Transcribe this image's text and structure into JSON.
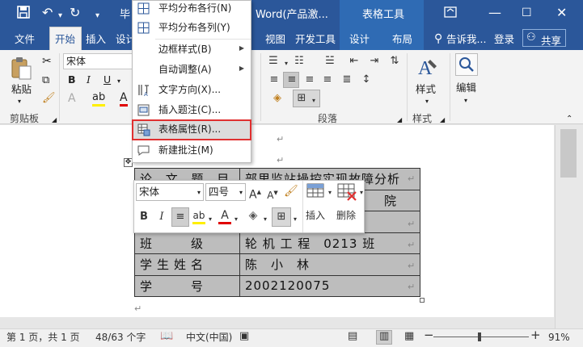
{
  "titlebar": {
    "doc_title_left": "毕",
    "doc_title_right": "Word(产品激...",
    "context_group": "表格工具"
  },
  "tabs": {
    "file": "文件",
    "home": "开始",
    "insert": "插入",
    "design_trunc": "设计",
    "view": "视图",
    "developer": "开发工具",
    "table_design": "设计",
    "table_layout": "布局",
    "tell_me": "告诉我...",
    "signin": "登录",
    "share": "共享"
  },
  "ribbon": {
    "font_name": "宋体",
    "paste_label": "粘贴",
    "clipboard_label": "剪贴板",
    "paragraph_label": "段落",
    "styles_label": "样式",
    "styles_group_label": "样式",
    "edit_label": "编辑",
    "bold": "B",
    "italic": "I",
    "underline": "U"
  },
  "context_menu": {
    "items": [
      {
        "label": "平均分布各行(N)"
      },
      {
        "label": "平均分布各列(Y)"
      },
      {
        "label": "边框样式(B)"
      },
      {
        "label": "自动调整(A)"
      },
      {
        "label": "文字方向(X)..."
      },
      {
        "label": "插入题注(C)..."
      },
      {
        "label": "表格属性(R)..."
      },
      {
        "label": "新建批注(M)"
      }
    ]
  },
  "minitoolbar": {
    "font": "宋体",
    "size": "四号",
    "bold": "B",
    "italic": "I",
    "insert_label": "插入",
    "delete_label": "删除"
  },
  "table": {
    "rows": [
      {
        "label": "论 文 题 目",
        "value": "部里监站操控实现故障分析"
      },
      {
        "label": "",
        "value": "院"
      },
      {
        "label": "",
        "value": ""
      },
      {
        "label": "班　　级",
        "value": "轮 机 工 程　0213 班"
      },
      {
        "label": "学生姓名",
        "value": "陈　小　林"
      },
      {
        "label": "学　　号",
        "value": "2002120075"
      }
    ]
  },
  "statusbar": {
    "page": "第 1 页，共 1 页",
    "words": "48/63 个字",
    "language": "中文(中国)",
    "zoom": "91%"
  }
}
